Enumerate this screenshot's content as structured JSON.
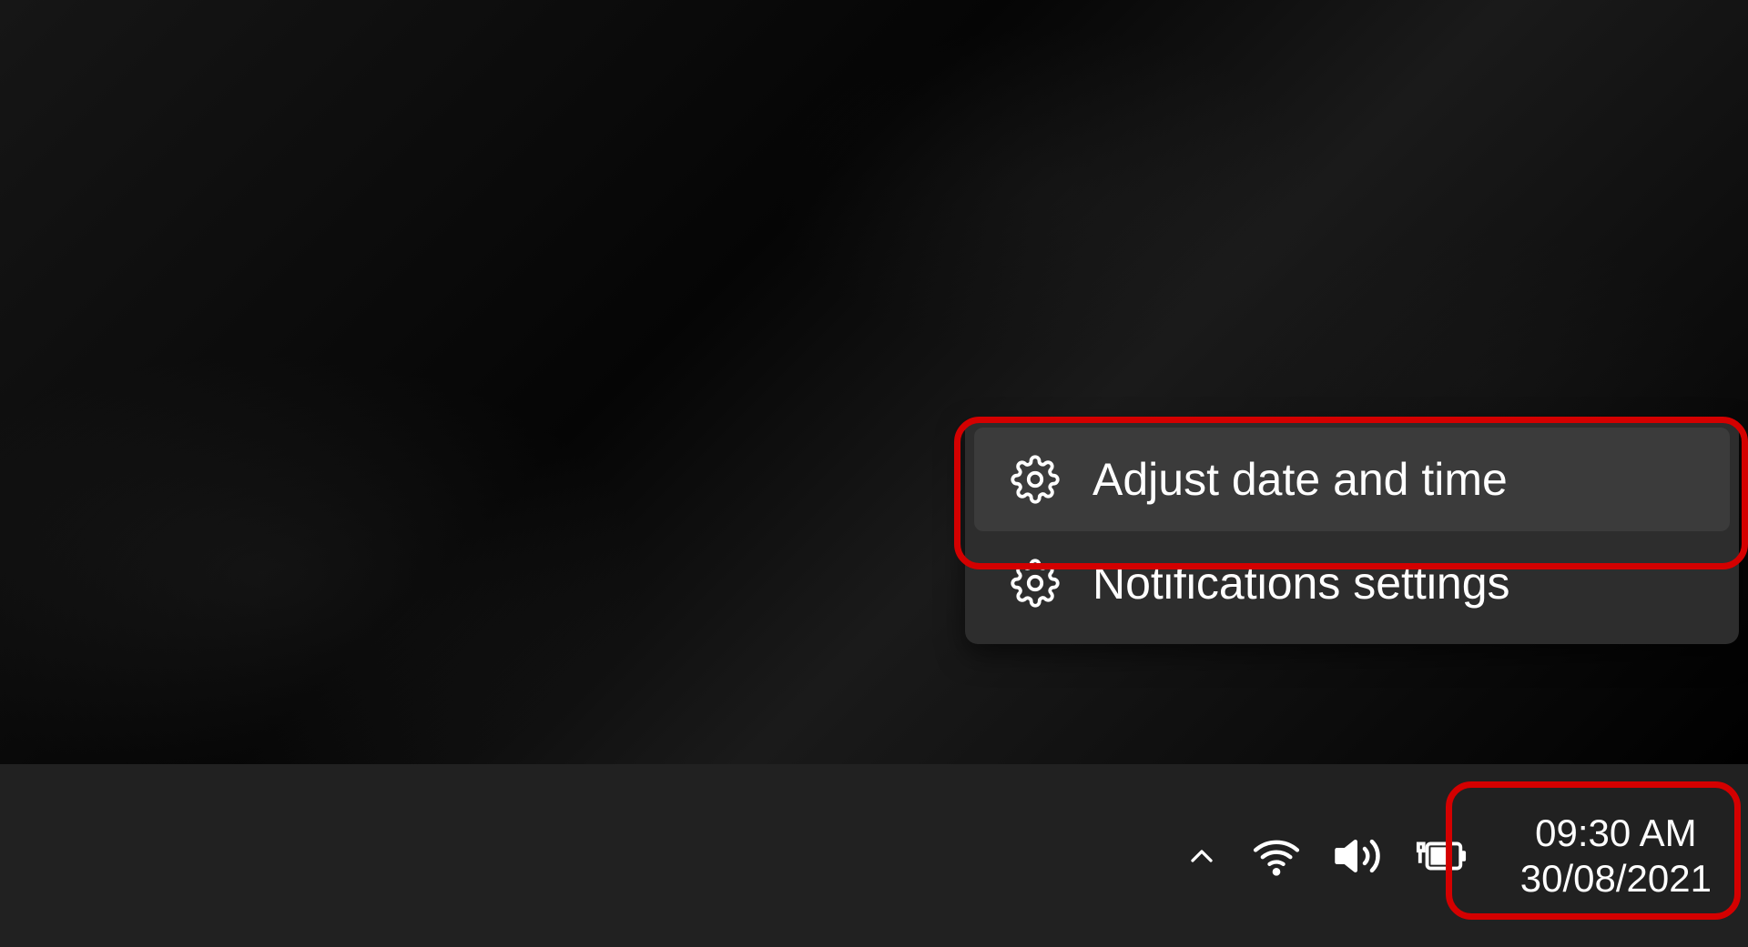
{
  "context_menu": {
    "items": [
      {
        "label": "Adjust date and time"
      },
      {
        "label": "Notifications settings"
      }
    ]
  },
  "taskbar": {
    "clock": {
      "time": "09:30 AM",
      "date": "30/08/2021"
    }
  }
}
